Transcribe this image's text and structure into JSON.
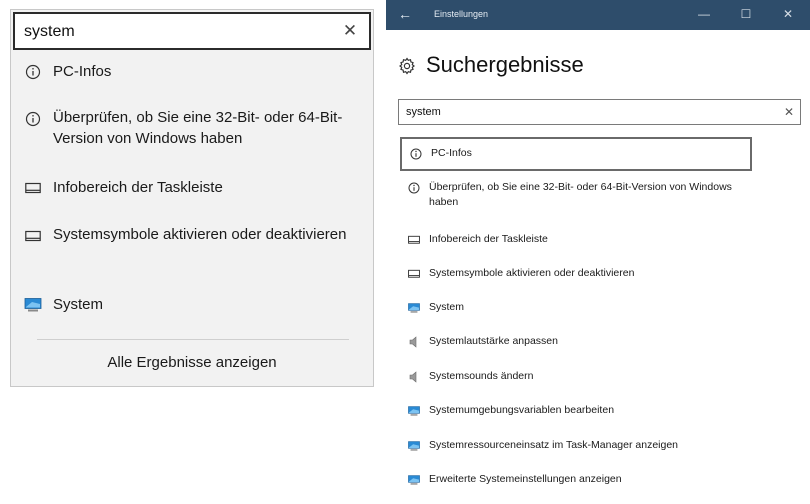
{
  "flyout": {
    "search_value": "system",
    "clear_glyph": "✕",
    "items": [
      {
        "label": "PC-Infos",
        "icon": "info-icon"
      },
      {
        "label": "Überprüfen, ob Sie eine 32-Bit- oder 64-Bit-Version von Windows haben",
        "icon": "info-icon"
      },
      {
        "label": "Infobereich der Taskleiste",
        "icon": "taskbar-icon"
      },
      {
        "label": "Systemsymbole aktivieren oder deaktivieren",
        "icon": "taskbar-icon"
      },
      {
        "label": "System",
        "icon": "monitor-icon"
      }
    ],
    "all_results_label": "Alle Ergebnisse anzeigen"
  },
  "window": {
    "title": "Einstellungen",
    "back_glyph": "←",
    "minimize_glyph": "—",
    "maximize_glyph": "☐",
    "close_glyph": "✕",
    "heading": "Suchergebnisse",
    "search_value": "system",
    "clear_glyph": "✕",
    "results": [
      {
        "label": "PC-Infos",
        "icon": "info-icon",
        "selected": true
      },
      {
        "label": "Überprüfen, ob Sie eine 32-Bit- oder 64-Bit-Version von Windows haben",
        "icon": "info-icon"
      },
      {
        "label": "Infobereich der Taskleiste",
        "icon": "taskbar-icon"
      },
      {
        "label": "Systemsymbole aktivieren oder deaktivieren",
        "icon": "taskbar-icon"
      },
      {
        "label": "System",
        "icon": "monitor-icon"
      },
      {
        "label": "Systemlautstärke anpassen",
        "icon": "speaker-icon"
      },
      {
        "label": "Systemsounds ändern",
        "icon": "speaker-icon"
      },
      {
        "label": "Systemumgebungsvariablen bearbeiten",
        "icon": "monitor-icon"
      },
      {
        "label": "Systemressourceneinsatz im Task-Manager anzeigen",
        "icon": "monitor-icon"
      },
      {
        "label": "Erweiterte Systemeinstellungen anzeigen",
        "icon": "monitor-icon"
      }
    ]
  },
  "colors": {
    "titlebar": "#2e4d6b",
    "flyout_bg": "#f2f2f2",
    "monitor_blue": "#2a8ad4"
  }
}
